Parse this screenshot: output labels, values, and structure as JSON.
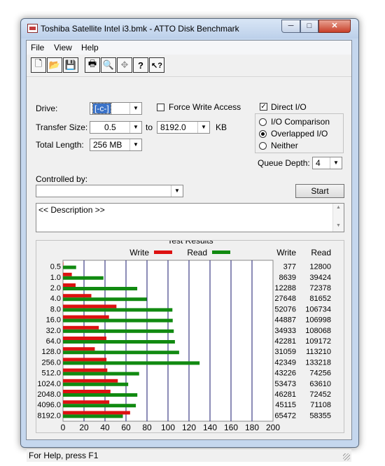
{
  "window": {
    "title": "Toshiba Satellite Intel i3.bmk - ATTO Disk Benchmark",
    "controls": {
      "minimize": "─",
      "maximize": "□",
      "close": "✕"
    }
  },
  "menu": [
    {
      "label": "File",
      "accel": "F"
    },
    {
      "label": "View",
      "accel": "V"
    },
    {
      "label": "Help",
      "accel": "H"
    }
  ],
  "toolbar": {
    "buttons": [
      {
        "name": "new-document-icon",
        "glyph": "🗋"
      },
      {
        "name": "open-folder-icon",
        "glyph": "📂"
      },
      {
        "name": "save-icon",
        "glyph": "💾"
      },
      {
        "name": "print-icon",
        "glyph": "🖶"
      },
      {
        "name": "print-preview-icon",
        "glyph": "🔍"
      },
      {
        "name": "move-icon",
        "glyph": "✥"
      },
      {
        "name": "help-icon",
        "glyph": "?"
      },
      {
        "name": "context-help-icon",
        "glyph": "↖?"
      }
    ]
  },
  "form": {
    "drive_label": "Drive:",
    "drive_value": "[-c-]",
    "force_write_label": "Force Write Access",
    "force_write_checked": false,
    "transfer_size_label": "Transfer Size:",
    "transfer_from": "0.5",
    "to_label": "to",
    "transfer_to": "8192.0",
    "kb_label": "KB",
    "total_length_label": "Total Length:",
    "total_length_value": "256 MB",
    "direct_io_label": "Direct I/O",
    "direct_io_checked": true,
    "io_comparison_label": "I/O Comparison",
    "overlapped_io_label": "Overlapped I/O",
    "neither_label": "Neither",
    "selected_mode": "Overlapped I/O",
    "queue_depth_label": "Queue Depth:",
    "queue_depth_value": "4",
    "controlled_by_label": "Controlled by:",
    "controlled_by_value": "",
    "start_label": "Start",
    "description_text": "<< Description >>"
  },
  "results": {
    "group_title": "Test Results",
    "write_legend": "Write",
    "read_legend": "Read",
    "write_col": "Write",
    "read_col": "Read",
    "rows": [
      {
        "size": "0.5",
        "write": "377",
        "read": "12800"
      },
      {
        "size": "1.0",
        "write": "8639",
        "read": "39424"
      },
      {
        "size": "2.0",
        "write": "12288",
        "read": "72378"
      },
      {
        "size": "4.0",
        "write": "27648",
        "read": "81652"
      },
      {
        "size": "8.0",
        "write": "52076",
        "read": "106734"
      },
      {
        "size": "16.0",
        "write": "44887",
        "read": "106998"
      },
      {
        "size": "32.0",
        "write": "34933",
        "read": "108068"
      },
      {
        "size": "64.0",
        "write": "42281",
        "read": "109172"
      },
      {
        "size": "128.0",
        "write": "31059",
        "read": "113210"
      },
      {
        "size": "256.0",
        "write": "42349",
        "read": "133218"
      },
      {
        "size": "512.0",
        "write": "43226",
        "read": "74256"
      },
      {
        "size": "1024.0",
        "write": "53473",
        "read": "63610"
      },
      {
        "size": "2048.0",
        "write": "46281",
        "read": "72452"
      },
      {
        "size": "4096.0",
        "write": "45115",
        "read": "71108"
      },
      {
        "size": "8192.0",
        "write": "65472",
        "read": "58355"
      }
    ]
  },
  "chart_data": {
    "type": "bar",
    "orientation": "horizontal",
    "categories": [
      "0.5",
      "1.0",
      "2.0",
      "4.0",
      "8.0",
      "16.0",
      "32.0",
      "64.0",
      "128.0",
      "256.0",
      "512.0",
      "1024.0",
      "2048.0",
      "4096.0",
      "8192.0"
    ],
    "series": [
      {
        "name": "Write",
        "color": "#dd1111",
        "values": [
          0.37,
          8.4,
          12.0,
          27.0,
          50.9,
          43.8,
          34.1,
          41.3,
          30.3,
          41.4,
          42.2,
          52.2,
          45.2,
          44.1,
          63.9
        ]
      },
      {
        "name": "Read",
        "color": "#118a11",
        "values": [
          12.5,
          38.5,
          70.7,
          79.7,
          104.2,
          104.5,
          105.5,
          106.6,
          110.6,
          130.1,
          72.5,
          62.1,
          70.8,
          69.4,
          57.0
        ]
      }
    ],
    "xlabel": "Transfer Rate - MB / Sec",
    "xlim": [
      0,
      200
    ],
    "xticks": [
      "0",
      "20",
      "40",
      "60",
      "80",
      "100",
      "120",
      "140",
      "160",
      "180",
      "200"
    ],
    "grid": true,
    "gridline_color": "#1a1a6e",
    "legend_position": "top"
  },
  "status": {
    "text": "For Help, press F1"
  }
}
